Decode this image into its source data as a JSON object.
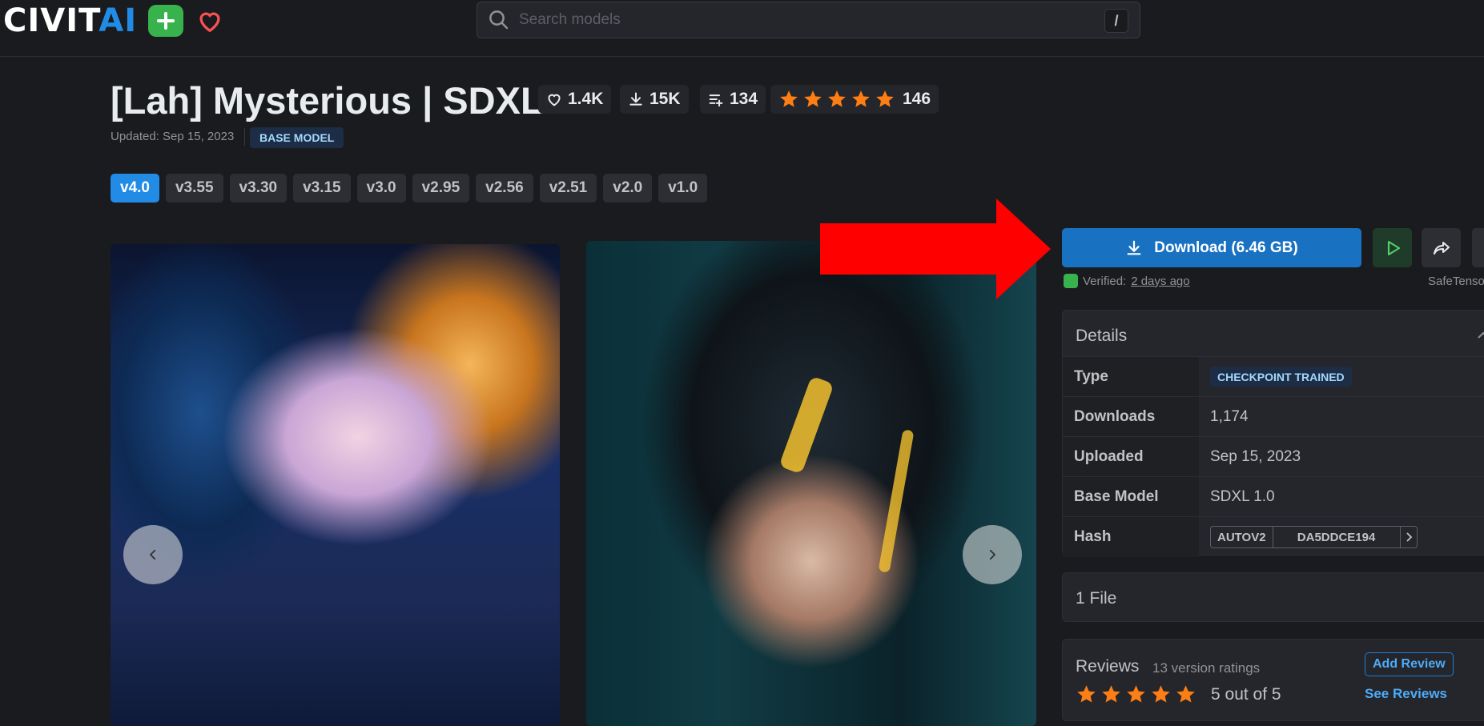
{
  "header": {
    "logo": {
      "text_main": "CIVIT",
      "text_accent": "AI"
    },
    "search": {
      "placeholder": "Search models",
      "shortcut": "/"
    }
  },
  "model": {
    "title": "[Lah] Mysterious | SDXL",
    "stats": {
      "likes": "1.4K",
      "downloads": "15K",
      "collections": "134",
      "rating_count": "146",
      "rating_stars": 5
    },
    "updated": "Updated: Sep 15, 2023",
    "badge": "BASE MODEL"
  },
  "versions": [
    "v4.0",
    "v3.55",
    "v3.30",
    "v3.15",
    "v3.0",
    "v2.95",
    "v2.56",
    "v2.51",
    "v2.0",
    "v1.0"
  ],
  "active_version": "v4.0",
  "download": {
    "label": "Download (6.46 GB)",
    "verified_prefix": "Verified:",
    "verified_time": "2 days ago",
    "format": "SafeTenso"
  },
  "details": {
    "heading": "Details",
    "rows": {
      "type": {
        "label": "Type",
        "value": "CHECKPOINT TRAINED"
      },
      "downloads": {
        "label": "Downloads",
        "value": "1,174"
      },
      "uploaded": {
        "label": "Uploaded",
        "value": "Sep 15, 2023"
      },
      "base_model": {
        "label": "Base Model",
        "value": "SDXL 1.0"
      },
      "hash": {
        "label": "Hash",
        "algo": "AUTOV2",
        "value": "DA5DDCE194"
      }
    }
  },
  "files": {
    "heading": "1 File"
  },
  "reviews": {
    "heading": "Reviews",
    "count": "13 version ratings",
    "score": "5 out of 5",
    "stars": 5,
    "add_label": "Add Review",
    "see_label": "See Reviews"
  },
  "colors": {
    "accent": "#228be6",
    "star": "#fd7e14",
    "arrow": "#ff0000",
    "verified": "#37b24d"
  }
}
